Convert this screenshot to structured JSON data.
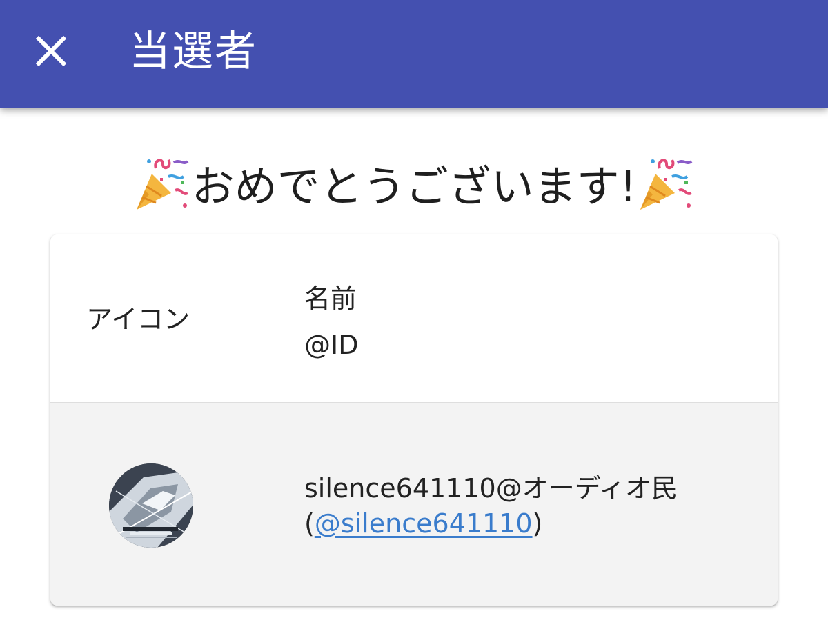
{
  "header": {
    "title": "当選者",
    "close_icon": "close-icon",
    "background_color": "#4450b0"
  },
  "congrats": {
    "text": "おめでとうございます!",
    "left_icon": "party-popper-icon",
    "right_icon": "party-popper-icon"
  },
  "table": {
    "columns": {
      "icon": "アイコン",
      "name": "名前",
      "id": "@ID"
    },
    "rows": [
      {
        "avatar_icon": "user-avatar",
        "name": "silence641110@オーディオ民",
        "id_open": "(",
        "id_link": "@silence641110",
        "id_close": ")"
      }
    ]
  },
  "colors": {
    "link": "#3a7ccc",
    "row_background": "#f3f3f3"
  }
}
